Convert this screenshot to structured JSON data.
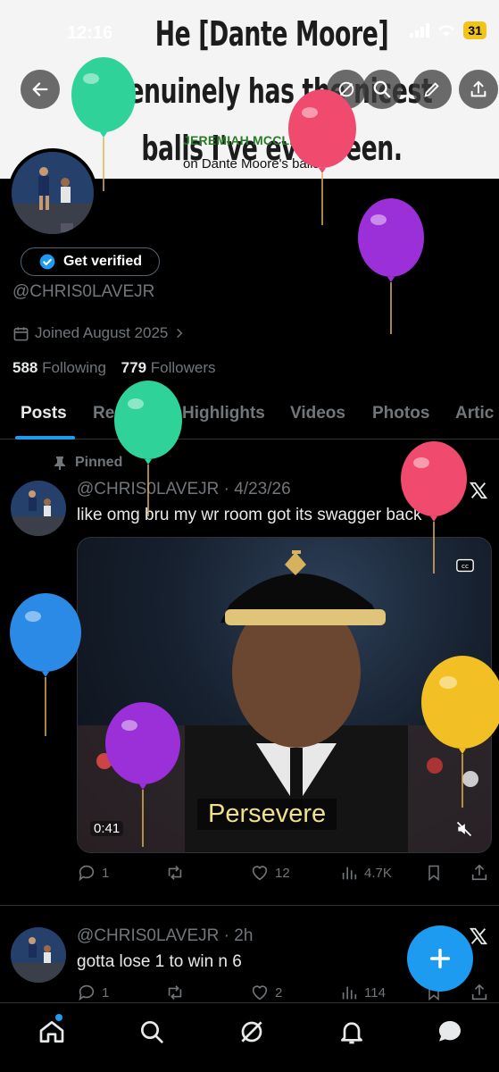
{
  "status_bar": {
    "time": "12:16",
    "battery": "31"
  },
  "banner": {
    "quote": "He [Dante Moore] genuinely has the nicest balls I've ever seen.",
    "author": "JEREMIAH MCCLELLAN",
    "source": "on Dante Moore's balls"
  },
  "profile": {
    "verify_label": "Get verified",
    "handle": "@CHRIS0LAVEJR",
    "joined": "Joined August 2025",
    "following_count": "588",
    "following_label": "Following",
    "followers_count": "779",
    "followers_label": "Followers"
  },
  "tabs": [
    "Posts",
    "Replies",
    "Highlights",
    "Videos",
    "Photos",
    "Artic"
  ],
  "posts": [
    {
      "pinned_label": "Pinned",
      "meta": "@CHRIS0LAVEJR · 4/23/26",
      "text": "like omg bru my wr room got its swagger back",
      "media": {
        "caption": "Persevere",
        "duration": "0:41"
      },
      "replies": "1",
      "reposts": "",
      "likes": "12",
      "views": "4.7K"
    },
    {
      "meta": "@CHRIS0LAVEJR · 2h",
      "text": "gotta lose 1 to win n 6",
      "replies": "1",
      "reposts": "",
      "likes": "2",
      "views": "114"
    }
  ],
  "colors": {
    "accent": "#1d9bf0",
    "background": "#000000",
    "muted": "#71767b"
  },
  "icons": [
    "back-icon",
    "share-icon",
    "search-icon",
    "edit-icon",
    "more-icon",
    "verified-badge-icon",
    "calendar-icon",
    "pin-icon",
    "x-logo-icon",
    "reply-icon",
    "repost-icon",
    "like-icon",
    "views-icon",
    "bookmark-icon",
    "home-icon",
    "grok-icon",
    "bell-icon",
    "chat-icon",
    "plus-icon"
  ]
}
